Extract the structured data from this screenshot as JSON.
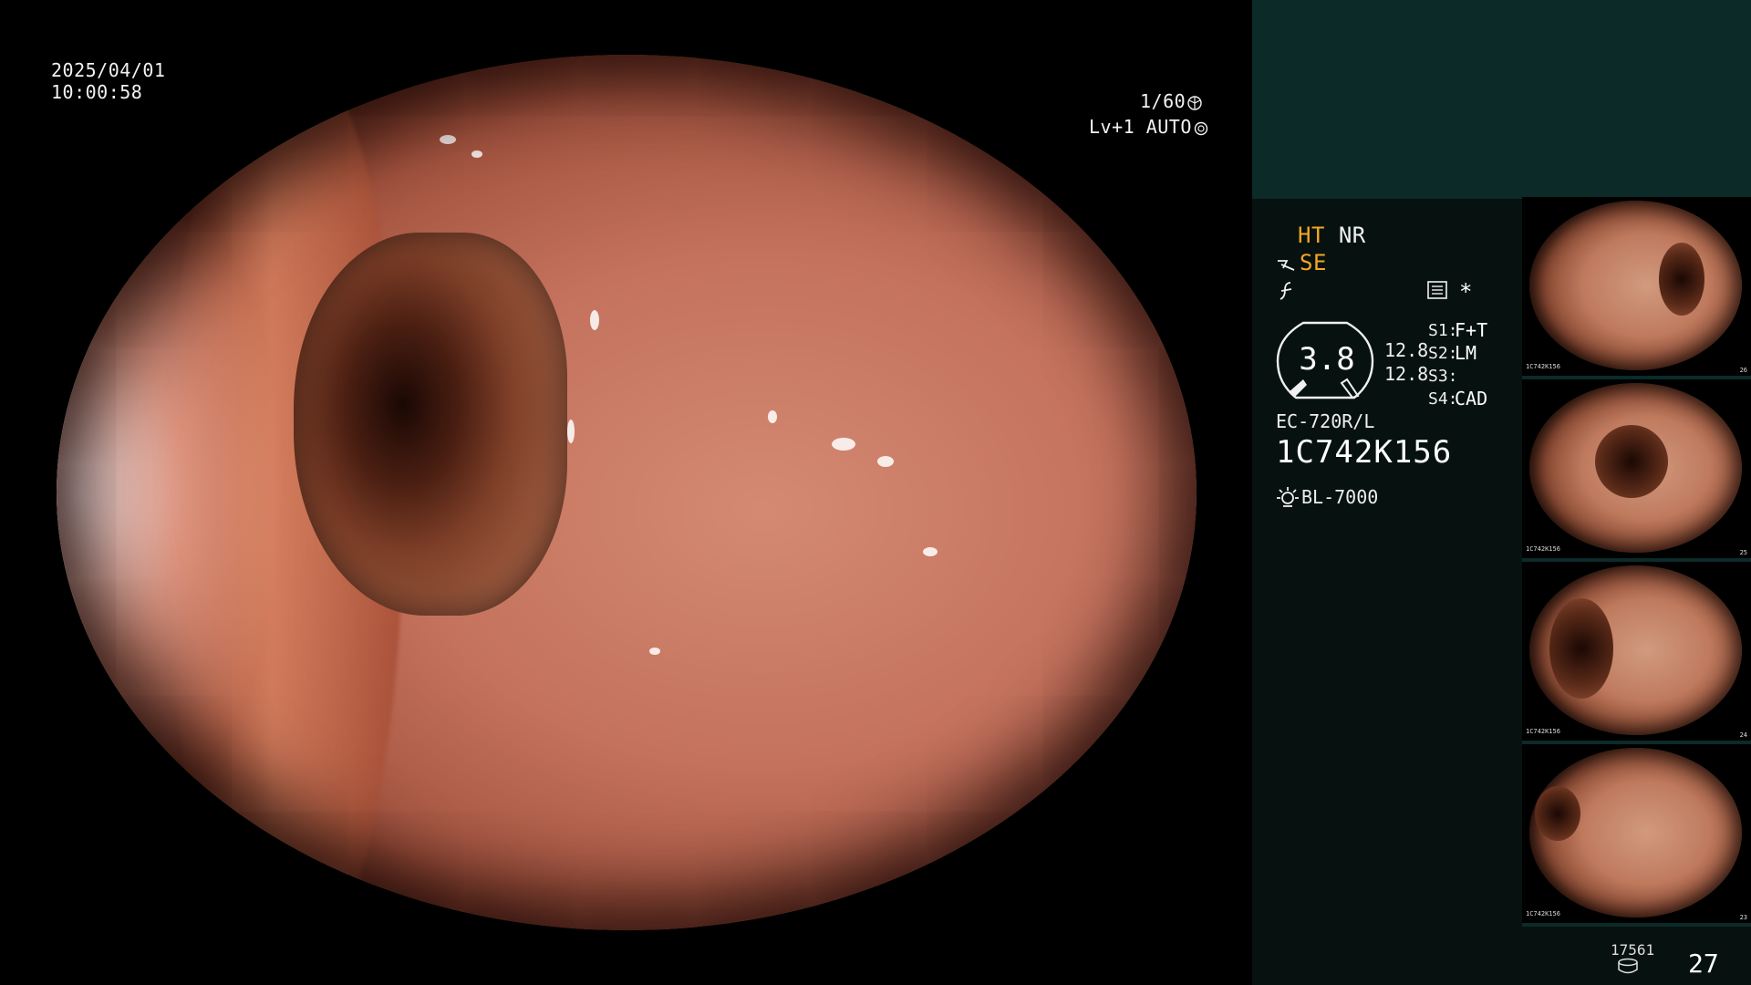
{
  "osd": {
    "date": "2025/04/01",
    "time": "10:00:58",
    "shutter": "1/60",
    "level_label": "Lv+1 AUTO"
  },
  "panel": {
    "mode_ht": "HT",
    "mode_nr": "NR",
    "mode_se": "SE",
    "zoom_value": "3.8",
    "zoom_a": "12.8",
    "zoom_b": "12.8",
    "s_slots": [
      {
        "label": "S1:",
        "value": "F+T"
      },
      {
        "label": "S2:",
        "value": "LM"
      },
      {
        "label": "S3:",
        "value": ""
      },
      {
        "label": "S4:",
        "value": "CAD"
      }
    ],
    "scope_model": "EC-720R/L",
    "scope_serial": "1C742K156",
    "light_source": "BL-7000",
    "star": "*"
  },
  "thumbnails": [
    {
      "serial": "1C742K156",
      "num": "26"
    },
    {
      "serial": "1C742K156",
      "num": "25"
    },
    {
      "serial": "1C742K156",
      "num": "24"
    },
    {
      "serial": "1C742K156",
      "num": "23"
    }
  ],
  "footer": {
    "capture_count_small": "17561",
    "capture_count_big": "27"
  },
  "colors": {
    "panel_bg": "#071210",
    "panel_top": "#0b2a28",
    "accent_orange": "#f5a623"
  }
}
